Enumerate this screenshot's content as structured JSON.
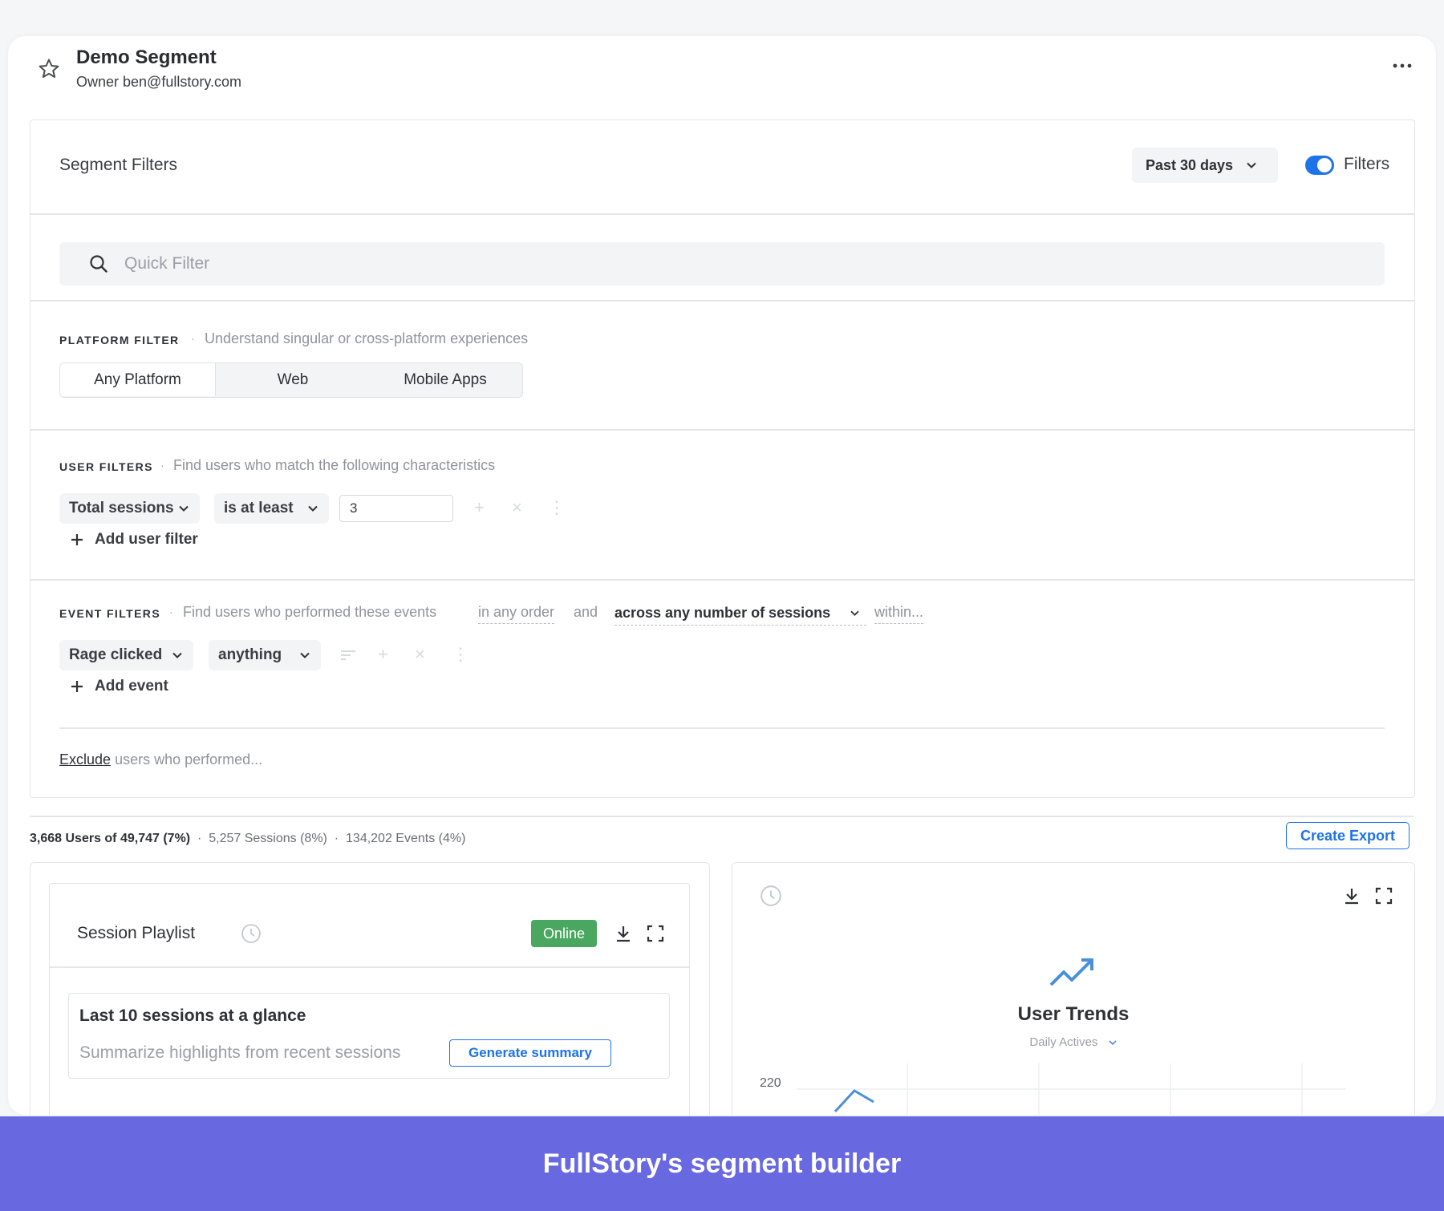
{
  "segment": {
    "title": "Demo Segment",
    "owner": "Owner ben@fullstory.com"
  },
  "filters": {
    "title": "Segment Filters",
    "date_range": "Past 30 days",
    "toggle_label": "Filters",
    "toggle_on": true,
    "quick_filter_placeholder": "Quick Filter"
  },
  "platform": {
    "label": "PLATFORM FILTER",
    "description": "Understand singular or cross-platform experiences",
    "options": [
      "Any Platform",
      "Web",
      "Mobile Apps"
    ],
    "selected": "Any Platform"
  },
  "user_filters": {
    "label": "USER FILTERS",
    "description": "Find users who match the following characteristics",
    "field": "Total sessions",
    "operator": "is at least",
    "value": "3",
    "add_label": "Add user filter"
  },
  "event_filters": {
    "label": "EVENT FILTERS",
    "description": "Find users who performed these events",
    "order": "in any order",
    "and_text": "and",
    "sessions": "across any number of sessions",
    "within": "within...",
    "event": "Rage clicked",
    "target": "anything",
    "add_label": "Add event",
    "exclude_link": "Exclude",
    "exclude_text": "users who performed..."
  },
  "stats": {
    "users": "3,668 Users of 49,747 (7%)",
    "sessions": "5,257 Sessions (8%)",
    "events": "134,202 Events (4%)",
    "export_label": "Create Export"
  },
  "session_playlist": {
    "title": "Session Playlist",
    "status": "Online",
    "glance_title": "Last 10 sessions at a glance",
    "glance_subtitle": "Summarize highlights from recent sessions",
    "generate_label": "Generate summary"
  },
  "user_trends": {
    "title": "User Trends",
    "metric": "Daily Actives",
    "y_tick": "220"
  },
  "caption": "FullStory's segment builder",
  "colors": {
    "accent": "#1e73e8",
    "online": "#4aa760",
    "banner": "#6869e0"
  }
}
